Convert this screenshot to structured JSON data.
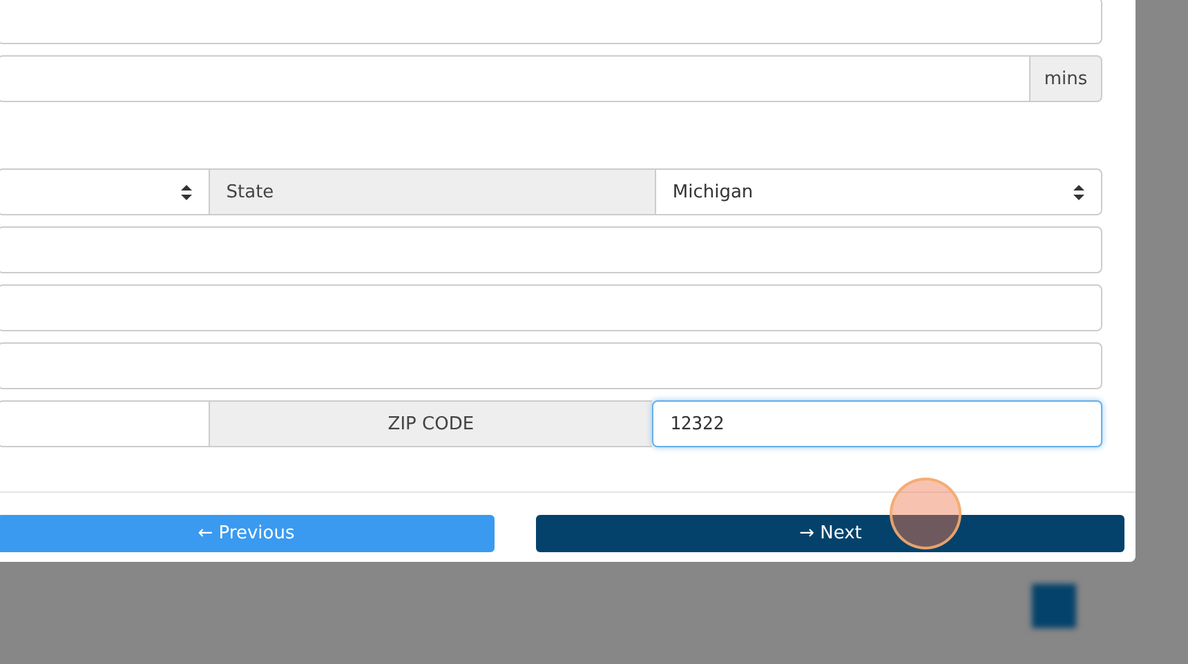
{
  "form": {
    "rows": [
      {
        "kind": "input",
        "value": ""
      },
      {
        "kind": "addon",
        "value": "",
        "addon": "mins"
      },
      {
        "kind": "spacer"
      },
      {
        "kind": "select-pair",
        "left_value": "",
        "label": "State",
        "right_value": "Michigan"
      },
      {
        "kind": "input",
        "value": ""
      },
      {
        "kind": "input",
        "value": ""
      },
      {
        "kind": "input",
        "value": ""
      },
      {
        "kind": "zip",
        "left_value": "",
        "label": "ZIP CODE",
        "value": "12322",
        "focused": true
      }
    ]
  },
  "buttons": [
    {
      "label": "← Previous",
      "kind": "secondary"
    },
    {
      "label": "→ Next",
      "kind": "primary"
    }
  ]
}
